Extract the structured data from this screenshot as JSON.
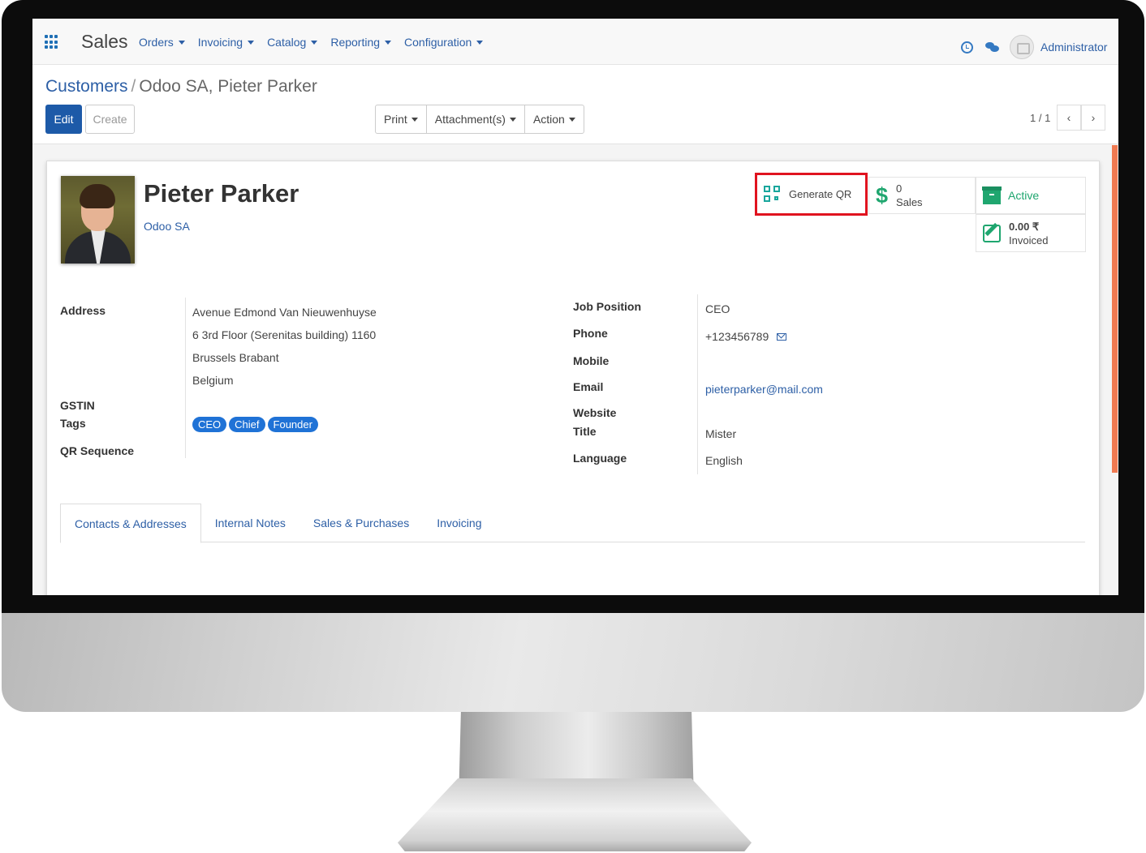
{
  "app": {
    "name": "Sales",
    "menu": [
      "Orders",
      "Invoicing",
      "Catalog",
      "Reporting",
      "Configuration"
    ],
    "user": "Administrator"
  },
  "breadcrumb": {
    "parent": "Customers",
    "separator": "/",
    "current": "Odoo SA, Pieter Parker"
  },
  "toolbar": {
    "edit": "Edit",
    "create": "Create",
    "print": "Print",
    "attachments": "Attachment(s)",
    "action": "Action",
    "pager": "1 / 1",
    "prev": "‹",
    "next": "›"
  },
  "partner": {
    "name": "Pieter Parker",
    "company": "Odoo SA"
  },
  "stat_buttons": {
    "generate_qr": "Generate QR",
    "sales_count": "0",
    "sales_label": "Sales",
    "active_label": "Active",
    "invoiced_amount": "0.00 ₹",
    "invoiced_label": "Invoiced"
  },
  "fields_left": {
    "address_label": "Address",
    "address_line1": "Avenue Edmond Van Nieuwenhuyse",
    "address_line2": "6 3rd Floor (Serenitas building) 1160",
    "address_line3": "Brussels  Brabant",
    "address_line4": "Belgium",
    "gstin_label": "GSTIN",
    "tags_label": "Tags",
    "tags": [
      "CEO",
      "Chief",
      "Founder"
    ],
    "qr_sequence_label": "QR Sequence"
  },
  "fields_right": {
    "job_position_label": "Job Position",
    "job_position": "CEO",
    "phone_label": "Phone",
    "phone": "+123456789",
    "mobile_label": "Mobile",
    "email_label": "Email",
    "email": "pieterparker@mail.com",
    "website_label": "Website",
    "title_label": "Title",
    "title": "Mister",
    "language_label": "Language",
    "language": "English"
  },
  "tabs": [
    "Contacts & Addresses",
    "Internal Notes",
    "Sales & Purchases",
    "Invoicing"
  ],
  "colors": {
    "link": "#2d5fa6",
    "primary_button": "#1d5aa8",
    "highlight_border": "#e0131f",
    "stat_green": "#1fa66f",
    "tag_blue": "#1f72d6"
  }
}
